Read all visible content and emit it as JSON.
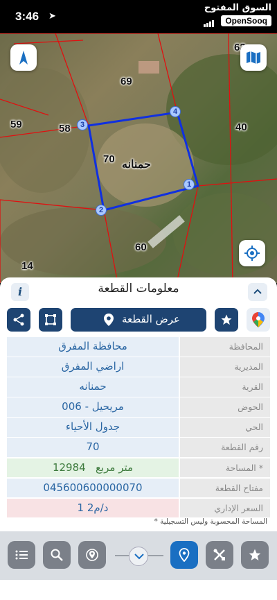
{
  "status": {
    "time": "3:46"
  },
  "brand": {
    "arabic": "السوق المفتوح",
    "name": "OpenSooq"
  },
  "map": {
    "labels": {
      "p63": "63",
      "p69": "69",
      "p59": "59",
      "p58": "58",
      "p40": "40",
      "p70": "70",
      "village": "حمنانه",
      "p60": "60",
      "p14": "14"
    },
    "vertices": {
      "v1": "1",
      "v2": "2",
      "v3": "3",
      "v4": "4"
    }
  },
  "panel": {
    "title": "معلومات القطعة",
    "info": "i",
    "show_plot": "عرض القطعة",
    "rows": [
      {
        "key": "المحافظة",
        "value": "محافظة المفرق"
      },
      {
        "key": "المديرية",
        "value": "اراضي المفرق"
      },
      {
        "key": "القرية",
        "value": "حمنانه"
      },
      {
        "key": "الحوض",
        "value": "مريحيل - 006"
      },
      {
        "key": "الحي",
        "value": "جدول الأحياء"
      },
      {
        "key": "رقم القطعة",
        "value": "70"
      },
      {
        "key": "المساحة *",
        "value": "12984   متر مربع"
      },
      {
        "key": "مفتاح القطعة",
        "value": "045600600000070"
      },
      {
        "key": "السعر الإداري",
        "value": "1 د/م2"
      }
    ],
    "note": "* المساحة المحسوبة وليس التسجيلية"
  },
  "colors": {
    "primary": "#1e4472",
    "active": "#1a6fc2",
    "plot_outline": "#1030e0",
    "parcel_line": "#e01010"
  }
}
